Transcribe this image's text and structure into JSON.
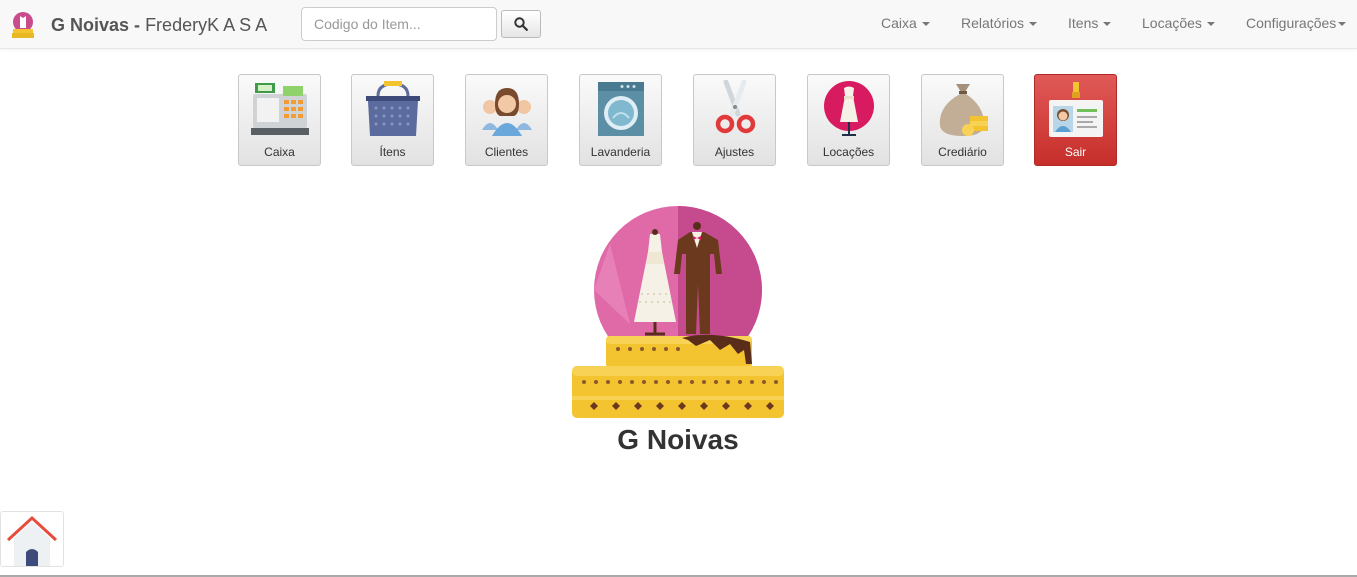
{
  "brand": {
    "name": "G Noivas",
    "separator": "-",
    "company": "FrederyK A S A"
  },
  "search": {
    "placeholder": "Codigo do Item...",
    "value": ""
  },
  "menu": [
    {
      "label": "Caixa",
      "has_caret": true
    },
    {
      "label": "Relatórios",
      "has_caret": true
    },
    {
      "label": "Itens",
      "has_caret": true
    },
    {
      "label": "Locações",
      "has_caret": true
    },
    {
      "label": "Configurações",
      "has_caret": true
    }
  ],
  "tiles": [
    {
      "label": "Caixa",
      "icon": "cash-register-icon"
    },
    {
      "label": "Ítens",
      "icon": "basket-icon"
    },
    {
      "label": "Clientes",
      "icon": "people-icon"
    },
    {
      "label": "Lavanderia",
      "icon": "washing-machine-icon"
    },
    {
      "label": "Ajustes",
      "icon": "scissors-icon"
    },
    {
      "label": "Locações",
      "icon": "dress-icon"
    },
    {
      "label": "Crediário",
      "icon": "money-bag-icon"
    },
    {
      "label": "Sair",
      "icon": "id-badge-icon",
      "style": "danger"
    }
  ],
  "main": {
    "title": "G Noivas"
  },
  "colors": {
    "danger": "#d9534f",
    "navbar": "#f8f8f8",
    "logo_pink": "#e06aa8",
    "logo_gold": "#f4c430"
  }
}
